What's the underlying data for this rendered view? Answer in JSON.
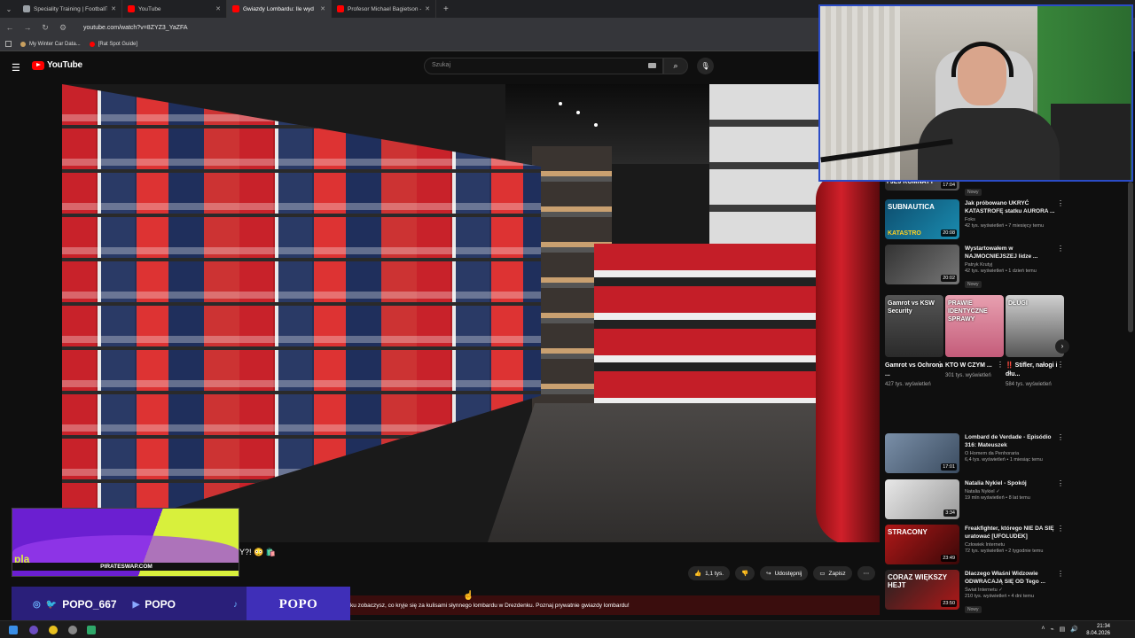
{
  "browser": {
    "tabs": [
      {
        "title": "Speciality Training | FootballTe",
        "active": false,
        "favicon_color": "#9aa0a6"
      },
      {
        "title": "YouTube",
        "active": false,
        "favicon_color": "#ff0000"
      },
      {
        "title": "Gwiazdy Lombardu: Ile wyd",
        "active": true,
        "favicon_color": "#ff0000"
      },
      {
        "title": "Profesor Michael Bagietson - ",
        "active": false,
        "favicon_color": "#ff0000"
      }
    ],
    "new_tab": "+",
    "url": "youtube.com/watch?v=8ZYZ3_YaZFA",
    "bookmarks": [
      {
        "label": "My Winter Car Data..."
      },
      {
        "label": "[Rat Spot Guide]"
      }
    ]
  },
  "youtube": {
    "logo_text": "YouTube",
    "search_placeholder": "Szukaj",
    "video_title_fragment": "Y?! 😳 🛍️",
    "actions": {
      "likes": "1,1 tys.",
      "share": "Udostępnij",
      "save": "Zapisz",
      "more": "⋯"
    },
    "description_snippet": "ku zobaczysz, co kryje się za kulisami słynnego lombardu w Drezdenku. Poznaj prywatnie gwiazdy lombardu!"
  },
  "sidebar": {
    "top_items": [
      {
        "title": "Jak próbowano UKRYĆ KATASTROFĘ statku AURORA ...",
        "channel": "Foks",
        "stats": "42 tys. wyświetleń • 7 miesięcy temu",
        "duration": "20:08",
        "thumb_text": "SUBNAUTICA",
        "thumb_sub": "KATASTRO",
        "new": false,
        "colors": [
          "#0d4d6e",
          "#1a8cb0"
        ]
      },
      {
        "title": "Wystartowałem w NAJMOCNIEJSZEJ lidze ...",
        "channel": "Patryk Krutyj",
        "stats": "42 tys. wyświetleń • 1 dzień temu",
        "duration": "20:02",
        "thumb_text": "",
        "thumb_sub": "",
        "new": true,
        "new_label": "Nowy",
        "colors": [
          "#333",
          "#777"
        ]
      }
    ],
    "partial_top": {
      "duration": "17:04",
      "thumb_text": "I JEJ KOMNATY",
      "new_label": "Nowy"
    },
    "shorts": [
      {
        "title": "Gamrot vs Ochrona ...",
        "views": "427 tys. wyświetleń",
        "overlay": "Gamrot vs KSW Security",
        "colors": [
          "#555",
          "#2a2a2a"
        ]
      },
      {
        "title": "KTO W CZYM ...",
        "views": "301 tys. wyświetleń",
        "overlay": "PRAWIE IDENTYCZNE SPRAWY",
        "colors": [
          "#e8a0b0",
          "#c45c7a"
        ]
      },
      {
        "title": "‼️ Stifler, nałogi i dłu...",
        "views": "584 tys. wyświetleń",
        "overlay": "DŁUGI",
        "colors": [
          "#d0d0d0",
          "#555"
        ]
      }
    ],
    "bottom_items": [
      {
        "title": "Lombard de Verdade - Episódio 316: Mateuszek",
        "channel": "O Homem da Penhoraria",
        "stats": "6,4 tys. wyświetleń • 1 miesiąc temu",
        "duration": "17:01",
        "thumb_text": "",
        "new": false,
        "colors": [
          "#7a8fa8",
          "#3b4c60"
        ]
      },
      {
        "title": "Natalia Nykiel - Spokój",
        "channel": "Natalia Nykiel ✓",
        "stats": "19 mln wyświetleń • 8 lat temu",
        "duration": "3:34",
        "thumb_text": "",
        "new": false,
        "colors": [
          "#e8e8e8",
          "#9a9a9a"
        ]
      },
      {
        "title": "Freakfighter, którego NIE DA SIĘ uratować [UFOLUDEK]",
        "channel": "Człowiek Internetu",
        "stats": "72 tys. wyświetleń • 2 tygodnie temu",
        "duration": "23:49",
        "thumb_text": "STRACONY",
        "new": false,
        "colors": [
          "#b01818",
          "#3a0808"
        ]
      },
      {
        "title": "Dlaczego Właśni Widzowie ODWRACAJĄ SIĘ OD Tego ...",
        "channel": "Świat Internetu ✓",
        "stats": "210 tys. wyświetleń • 4 dni temu",
        "duration": "23:50",
        "thumb_text": "CORAZ WIĘKSZY HEJT",
        "new": true,
        "new_label": "Nowy",
        "colors": [
          "#222",
          "#b01818"
        ]
      }
    ]
  },
  "overlay": {
    "promo_site": "PIRATESWAP.COM",
    "promo_art": "pla",
    "social_handle": "POPO_667",
    "youtube_handle": "POPO",
    "brand": "POPO"
  },
  "taskbar": {
    "time": "21:34",
    "date": "8.04.2026"
  }
}
